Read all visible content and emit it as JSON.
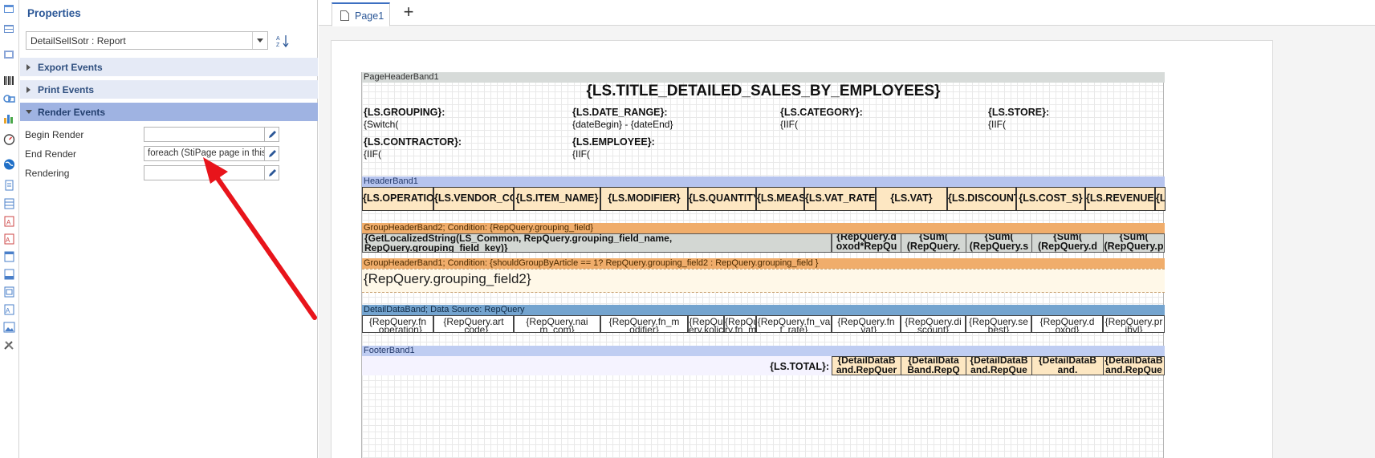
{
  "properties": {
    "title": "Properties",
    "object_selector": "DetailSellSotr : Report",
    "categories": [
      "Export Events",
      "Print Events",
      "Render Events"
    ],
    "render_events": [
      {
        "label": "Begin Render",
        "value": ""
      },
      {
        "label": "End Render",
        "value": "foreach (StiPage page in this."
      },
      {
        "label": "Rendering",
        "value": ""
      }
    ]
  },
  "tabs": [
    {
      "label": "Page1"
    }
  ],
  "colors": {
    "accent": "#2b5797",
    "header_band": "#b6c4ee",
    "group_band": "#f0ad6b",
    "data_band": "#74a4cf",
    "annotation_arrow": "#e8141b"
  },
  "report": {
    "page_header": {
      "band": "PageHeaderBand1",
      "title": "{LS.TITLE_DETAILED_SALES_BY_EMPLOYEES}",
      "fields": [
        {
          "label": "{LS.GROUPING}:",
          "value": "{Switch("
        },
        {
          "label": "{LS.DATE_RANGE}:",
          "value": "{dateBegin} - {dateEnd}"
        },
        {
          "label": "{LS.CATEGORY}:",
          "value": "{IIF("
        },
        {
          "label": "{LS.STORE}:",
          "value": "{IIF("
        },
        {
          "label": "{LS.CONTRACTOR}:",
          "value": "{IIF("
        },
        {
          "label": "{LS.EMPLOYEE}:",
          "value": "{IIF("
        }
      ]
    },
    "header_band": {
      "band": "HeaderBand1",
      "columns": [
        "{LS.OPERATION}",
        "{LS.VENDOR_CODE}",
        "{LS.ITEM_NAME}",
        "{LS.MODIFIER}",
        "{LS.QUANTITY}",
        "{LS.MEASURE}",
        "{LS.VAT_RATE}",
        "{LS.VAT}",
        "{LS.DISCOUNT}",
        "{LS.COST_S}",
        "{LS.REVENUE}",
        "{LS.PROFIT}"
      ]
    },
    "group_header_2": {
      "band": "GroupHeaderBand2; Condition: {RepQuery.grouping_field}",
      "text_line1": "{GetLocalizedString(LS_Common, RepQuery.grouping_field_name,",
      "text_line2": "RepQuery.grouping_field_key)}",
      "totals": [
        {
          "line1": "{RepQuery.d",
          "line2": "oxod*RepQu"
        },
        {
          "line1": "{Sum(",
          "line2": "(RepQuery."
        },
        {
          "line1": "{Sum(",
          "line2": "(RepQuery.s"
        },
        {
          "line1": "{Sum(",
          "line2": "(RepQuery.d"
        },
        {
          "line1": "{Sum(",
          "line2": "(RepQuery.p"
        }
      ]
    },
    "group_header_1": {
      "band": "GroupHeaderBand1; Condition: {shouldGroupByArticle == 1? RepQuery.grouping_field2 : RepQuery.grouping_field }",
      "text": "{RepQuery.grouping_field2}"
    },
    "data_band": {
      "band": "DetailDataBand; Data Source: RepQuery",
      "cells": [
        {
          "line1": "{RepQuery.fn",
          "line2": "_operation}"
        },
        {
          "line1": "{RepQuery.art",
          "line2": "_code}"
        },
        {
          "line1": "{RepQuery.nai",
          "line2": "m_com}"
        },
        {
          "line1": "{RepQuery.fn_m",
          "line2": "odifier}"
        },
        {
          "line1": "{RepQu",
          "line2": "ery.kolic"
        },
        {
          "line1": "{RepQue",
          "line2": "ry.fn_me"
        },
        {
          "line1": "{RepQuery.fn_va",
          "line2": "t_rate}"
        },
        {
          "line1": "{RepQuery.fn",
          "line2": "_vat}"
        },
        {
          "line1": "{RepQuery.di",
          "line2": "scount}"
        },
        {
          "line1": "{RepQuery.se",
          "line2": "best}"
        },
        {
          "line1": "{RepQuery.d",
          "line2": "oxod}"
        },
        {
          "line1": "{RepQuery.pr",
          "line2": "ibyl}"
        }
      ]
    },
    "footer_band": {
      "band": "FooterBand1",
      "total_label": "{LS.TOTAL}:",
      "totals": [
        {
          "line1": "{DetailDataB",
          "line2": "and.RepQuer"
        },
        {
          "line1": "{DetailData",
          "line2": "Band.RepQ"
        },
        {
          "line1": "{DetailDataB",
          "line2": "and.RepQue"
        },
        {
          "line1": "{DetailDataB",
          "line2": "and."
        },
        {
          "line1": "{DetailDataB",
          "line2": "and.RepQue"
        }
      ]
    }
  }
}
